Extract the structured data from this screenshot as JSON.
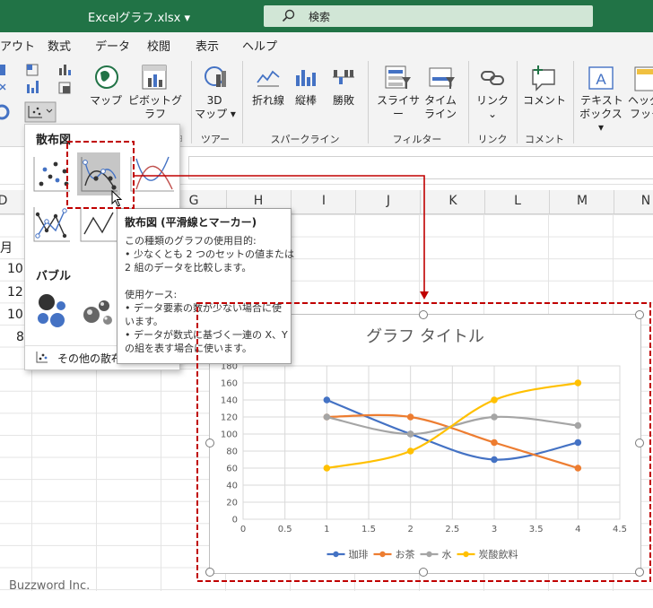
{
  "title_bar": {
    "filename": "Excelグラフ.xlsx ▾",
    "search_placeholder": "検索"
  },
  "menu": [
    "アウト",
    "数式",
    "データ",
    "校閲",
    "表示",
    "ヘルプ"
  ],
  "ribbon": {
    "map": "マップ",
    "pivot_chart": "ピボットグラフ",
    "map3d_top": "3D",
    "map3d_bottom": "マップ ▾",
    "line": "折れ線",
    "column": "縦棒",
    "winloss": "勝敗",
    "slicer": "スライサー",
    "timeline_top": "タイム",
    "timeline_bottom": "ライン",
    "link": "リンク",
    "comment": "コメント",
    "textbox_top": "テキスト",
    "textbox_bottom": "ボックス ▾",
    "header_top": "ヘッダー",
    "header_bottom": "フッタ",
    "groups": {
      "tours": "ツアー",
      "sparklines": "スパークライン",
      "filters": "フィルター",
      "links": "リンク",
      "comments": "コメント"
    }
  },
  "columns": [
    "D",
    "G",
    "H",
    "I",
    "J",
    "K",
    "L",
    "M",
    "N"
  ],
  "cells": [
    "月",
    "10",
    "12",
    "10",
    "8"
  ],
  "dropdown": {
    "scatter_header": "散布図",
    "bubble_header": "バブル",
    "more_scatter": "その他の散布"
  },
  "tooltip": {
    "title": "散布図 (平滑線とマーカー)",
    "lines": [
      "この種類のグラフの使用目的:",
      "• 少なくとも 2 つのセットの値または",
      "2 組のデータを比較します。",
      "",
      "使用ケース:",
      "• データ要素の数が少ない場合に使",
      "います。",
      "• データが数式に基づく一連の X、Y",
      "の組を表す場合に使います。"
    ]
  },
  "chart_data": {
    "type": "scatter",
    "title": "グラフ タイトル",
    "x": [
      1,
      2,
      3,
      4
    ],
    "xlim": [
      0,
      4.5
    ],
    "xticks": [
      "0",
      "0.5",
      "1",
      "1.5",
      "2",
      "2.5",
      "3",
      "3.5",
      "4",
      "4.5"
    ],
    "ylim": [
      0,
      180
    ],
    "yticks": [
      "0",
      "20",
      "40",
      "60",
      "80",
      "100",
      "120",
      "140",
      "160",
      "180"
    ],
    "smooth": true,
    "grid": true,
    "legend_position": "bottom",
    "series": [
      {
        "name": "珈琲",
        "color": "#4472c4",
        "values": [
          140,
          100,
          70,
          90
        ]
      },
      {
        "name": "お茶",
        "color": "#ed7d31",
        "values": [
          120,
          120,
          90,
          60
        ]
      },
      {
        "name": "水",
        "color": "#a5a5a5",
        "values": [
          120,
          100,
          120,
          110
        ]
      },
      {
        "name": "炭酸飲料",
        "color": "#ffc000",
        "values": [
          60,
          80,
          140,
          160
        ]
      }
    ]
  },
  "watermark": "Buzzword Inc.",
  "colors": {
    "excel_green": "#217346",
    "highlight_red": "#c00000"
  }
}
